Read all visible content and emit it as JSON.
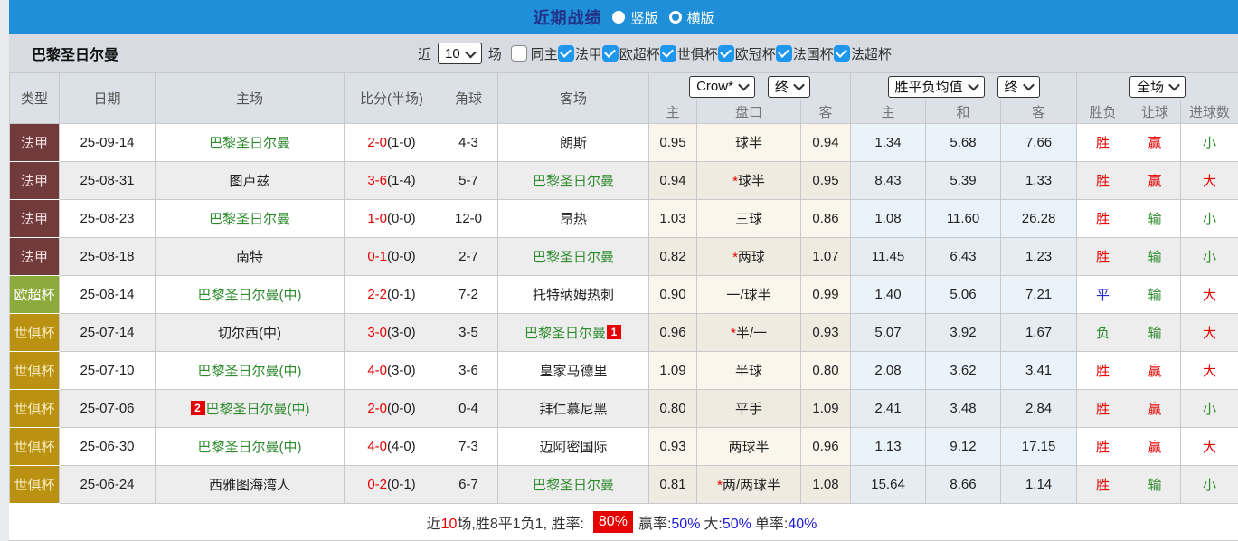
{
  "topbar": {
    "title": "近期战绩",
    "vertical_option": "竖版",
    "horizontal_option": "横版"
  },
  "filterbar": {
    "team": "巴黎圣日尔曼",
    "near_label": "近",
    "matches_count": "10",
    "matches_label": "场",
    "same_home_label": "同主",
    "competitions": [
      "法甲",
      "欧超杯",
      "世俱杯",
      "欧冠杯",
      "法国杯",
      "法超杯"
    ]
  },
  "table": {
    "columns": {
      "type": "类型",
      "date": "日期",
      "home": "主场",
      "score": "比分(半场)",
      "corner": "角球",
      "away": "客场",
      "odds_home": "主",
      "odds_line": "盘口",
      "odds_away": "客",
      "mean_home": "主",
      "mean_draw": "和",
      "mean_away": "客",
      "result": "胜负",
      "handicap": "让球",
      "goals": "进球数"
    },
    "selects": {
      "bookmaker": "Crow*",
      "bookmaker_period": "终",
      "avg": "胜平负均值",
      "avg_period": "终",
      "scope": "全场"
    },
    "type_styles": {
      "法甲": {
        "bg": "#713b3b",
        "fg": "#f2dede"
      },
      "欧超杯": {
        "bg": "#8dab3c",
        "fg": "#ffffff"
      },
      "世俱杯": {
        "bg": "#ba9110",
        "fg": "#f8ecc0"
      }
    },
    "rows": [
      {
        "type": "法甲",
        "date": "25-09-14",
        "home": "巴黎圣日尔曼",
        "home_psg": true,
        "home_badge": "",
        "score": "2-0",
        "half": "(1-0)",
        "corner": "4-3",
        "away": "朗斯",
        "away_psg": false,
        "away_badge": "",
        "odds_home": "0.95",
        "handicap": "球半",
        "odds_away": "0.94",
        "mean_home": "1.34",
        "mean_draw": "5.68",
        "mean_away": "7.66",
        "result": "胜",
        "handicap_result": "赢",
        "goals": "小"
      },
      {
        "type": "法甲",
        "date": "25-08-31",
        "home": "图卢兹",
        "home_psg": false,
        "home_badge": "",
        "score": "3-6",
        "half": "(1-4)",
        "corner": "5-7",
        "away": "巴黎圣日尔曼",
        "away_psg": true,
        "away_badge": "",
        "odds_home": "0.94",
        "handicap": "*球半",
        "odds_away": "0.95",
        "mean_home": "8.43",
        "mean_draw": "5.39",
        "mean_away": "1.33",
        "result": "胜",
        "handicap_result": "赢",
        "goals": "大"
      },
      {
        "type": "法甲",
        "date": "25-08-23",
        "home": "巴黎圣日尔曼",
        "home_psg": true,
        "home_badge": "",
        "score": "1-0",
        "half": "(0-0)",
        "corner": "12-0",
        "away": "昂热",
        "away_psg": false,
        "away_badge": "",
        "odds_home": "1.03",
        "handicap": "三球",
        "odds_away": "0.86",
        "mean_home": "1.08",
        "mean_draw": "11.60",
        "mean_away": "26.28",
        "result": "胜",
        "handicap_result": "输",
        "goals": "小"
      },
      {
        "type": "法甲",
        "date": "25-08-18",
        "home": "南特",
        "home_psg": false,
        "home_badge": "",
        "score": "0-1",
        "half": "(0-0)",
        "corner": "2-7",
        "away": "巴黎圣日尔曼",
        "away_psg": true,
        "away_badge": "",
        "odds_home": "0.82",
        "handicap": "*两球",
        "odds_away": "1.07",
        "mean_home": "11.45",
        "mean_draw": "6.43",
        "mean_away": "1.23",
        "result": "胜",
        "handicap_result": "输",
        "goals": "小"
      },
      {
        "type": "欧超杯",
        "date": "25-08-14",
        "home": "巴黎圣日尔曼(中)",
        "home_psg": true,
        "home_badge": "",
        "score": "2-2",
        "half": "(0-1)",
        "corner": "7-2",
        "away": "托特纳姆热刺",
        "away_psg": false,
        "away_badge": "",
        "odds_home": "0.90",
        "handicap": "一/球半",
        "odds_away": "0.99",
        "mean_home": "1.40",
        "mean_draw": "5.06",
        "mean_away": "7.21",
        "result": "平",
        "handicap_result": "输",
        "goals": "大"
      },
      {
        "type": "世俱杯",
        "date": "25-07-14",
        "home": "切尔西(中)",
        "home_psg": false,
        "home_badge": "",
        "score": "3-0",
        "half": "(3-0)",
        "corner": "3-5",
        "away": "巴黎圣日尔曼",
        "away_psg": true,
        "away_badge": "1",
        "odds_home": "0.96",
        "handicap": "*半/一",
        "odds_away": "0.93",
        "mean_home": "5.07",
        "mean_draw": "3.92",
        "mean_away": "1.67",
        "result": "负",
        "handicap_result": "输",
        "goals": "大"
      },
      {
        "type": "世俱杯",
        "date": "25-07-10",
        "home": "巴黎圣日尔曼(中)",
        "home_psg": true,
        "home_badge": "",
        "score": "4-0",
        "half": "(3-0)",
        "corner": "3-6",
        "away": "皇家马德里",
        "away_psg": false,
        "away_badge": "",
        "odds_home": "1.09",
        "handicap": "半球",
        "odds_away": "0.80",
        "mean_home": "2.08",
        "mean_draw": "3.62",
        "mean_away": "3.41",
        "result": "胜",
        "handicap_result": "赢",
        "goals": "大"
      },
      {
        "type": "世俱杯",
        "date": "25-07-06",
        "home": "巴黎圣日尔曼(中)",
        "home_psg": true,
        "home_badge": "2",
        "score": "2-0",
        "half": "(0-0)",
        "corner": "0-4",
        "away": "拜仁慕尼黑",
        "away_psg": false,
        "away_badge": "",
        "odds_home": "0.80",
        "handicap": "平手",
        "odds_away": "1.09",
        "mean_home": "2.41",
        "mean_draw": "3.48",
        "mean_away": "2.84",
        "result": "胜",
        "handicap_result": "赢",
        "goals": "小"
      },
      {
        "type": "世俱杯",
        "date": "25-06-30",
        "home": "巴黎圣日尔曼(中)",
        "home_psg": true,
        "home_badge": "",
        "score": "4-0",
        "half": "(4-0)",
        "corner": "7-3",
        "away": "迈阿密国际",
        "away_psg": false,
        "away_badge": "",
        "odds_home": "0.93",
        "handicap": "两球半",
        "odds_away": "0.96",
        "mean_home": "1.13",
        "mean_draw": "9.12",
        "mean_away": "17.15",
        "result": "胜",
        "handicap_result": "赢",
        "goals": "大"
      },
      {
        "type": "世俱杯",
        "date": "25-06-24",
        "home": "西雅图海湾人",
        "home_psg": false,
        "home_badge": "",
        "score": "0-2",
        "half": "(0-1)",
        "corner": "6-7",
        "away": "巴黎圣日尔曼",
        "away_psg": true,
        "away_badge": "",
        "odds_home": "0.81",
        "handicap": "*两/两球半",
        "odds_away": "1.08",
        "mean_home": "15.64",
        "mean_draw": "8.66",
        "mean_away": "1.14",
        "result": "胜",
        "handicap_result": "输",
        "goals": "小"
      }
    ]
  },
  "summary": {
    "part1": "近",
    "count": "10",
    "part2": "场,胜8平1负1, 胜率:",
    "win_rate": "80%",
    "win_label": "赢率:",
    "win_value": "50%",
    "big_label": "大:",
    "big_value": "50%",
    "single_label": "单率:",
    "single_value": "40%"
  },
  "colors": {
    "accent_blue": "#1e8fd8",
    "score_red": "#e60000",
    "psg_green": "#2e8b2e",
    "value_blue": "#1b1bd8"
  }
}
